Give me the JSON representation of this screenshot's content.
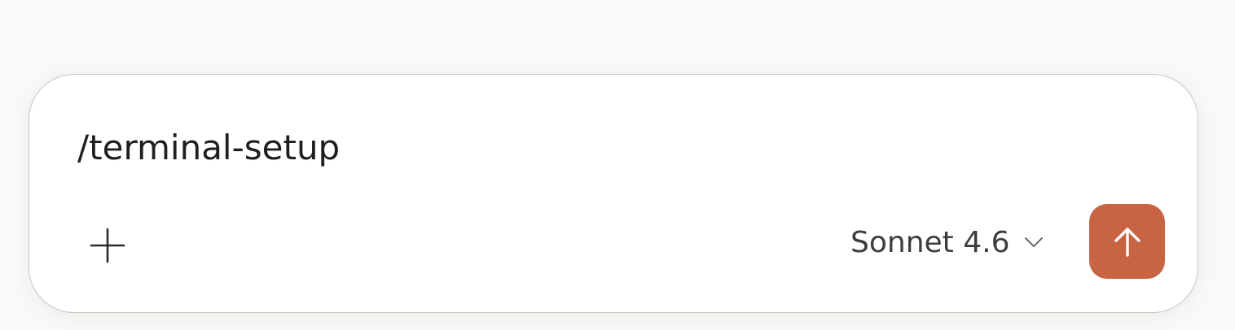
{
  "composer": {
    "input_value": "/terminal-setup",
    "add_icon": "plus-icon",
    "model_label": "Sonnet 4.6",
    "model_chevron_icon": "chevron-down-icon",
    "send_icon": "arrow-up-icon"
  },
  "colors": {
    "page_background": "#faf9f7",
    "composer_background": "#ffffff",
    "composer_border": "#c9c7c2",
    "send_button": "#c96442",
    "send_icon": "#ffffff",
    "text": "#1f1f1e"
  }
}
